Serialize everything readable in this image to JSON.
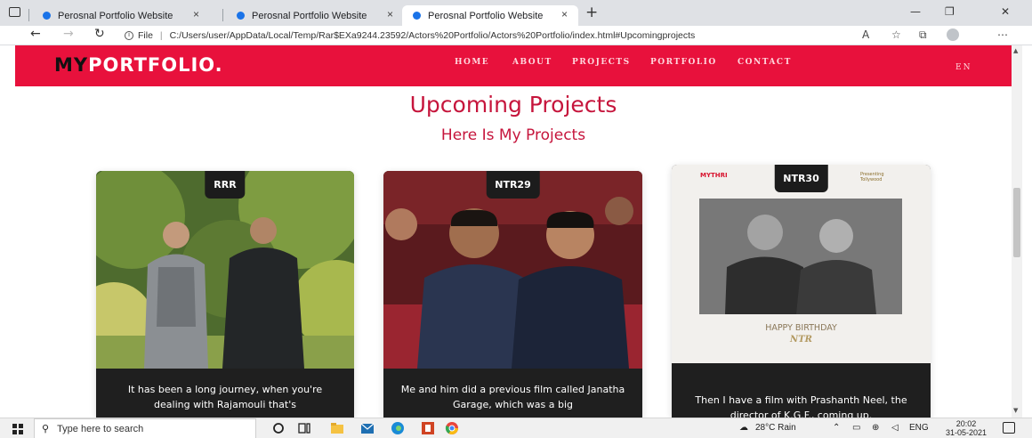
{
  "browser": {
    "tabs": [
      {
        "title": "Perosnal Portfolio Website"
      },
      {
        "title": "Perosnal Portfolio Website"
      },
      {
        "title": "Perosnal Portfolio Website"
      }
    ],
    "new_tab": "+",
    "close_glyph": "×",
    "window_controls": {
      "minimize": "—",
      "restore": "❐",
      "close": "✕"
    },
    "address": {
      "scheme_label": "File",
      "url": "C:/Users/user/AppData/Local/Temp/Rar$EXa9244.23592/Actors%20Portfolio/Actors%20Portfolio/index.html#Upcomingprojects"
    }
  },
  "site": {
    "logo_my": "MY",
    "logo_rest": "PORTFOLIO.",
    "nav": [
      "HOME",
      "ABOUT",
      "PROJECTS",
      "PORTFOLIO",
      "CONTACT"
    ],
    "lang": "EN",
    "colors": {
      "accent": "#e8113c",
      "heading": "#c6153c"
    }
  },
  "section": {
    "title": "Upcoming Projects",
    "subtitle": "Here Is My Projects"
  },
  "cards": [
    {
      "badge": "RRR",
      "text": "It has been a long journey, when you're dealing with Rajamouli that's"
    },
    {
      "badge": "NTR29",
      "text": "Me and him did a previous film called Janatha Garage, which was a big"
    },
    {
      "badge": "NTR30",
      "text": "Then I have a film with Prashanth Neel, the director of K.G.F., coming up.",
      "poster_brand_left": "MYTHRI",
      "poster_brand_right": "Presenting Tollywood",
      "poster_caption_line1": "HAPPY BIRTHDAY",
      "poster_caption_line2": "NTR"
    }
  ],
  "taskbar": {
    "search_placeholder": "Type here to search",
    "weather": "28°C  Rain",
    "language": "ENG",
    "time": "20:02",
    "date": "31-05-2021"
  }
}
